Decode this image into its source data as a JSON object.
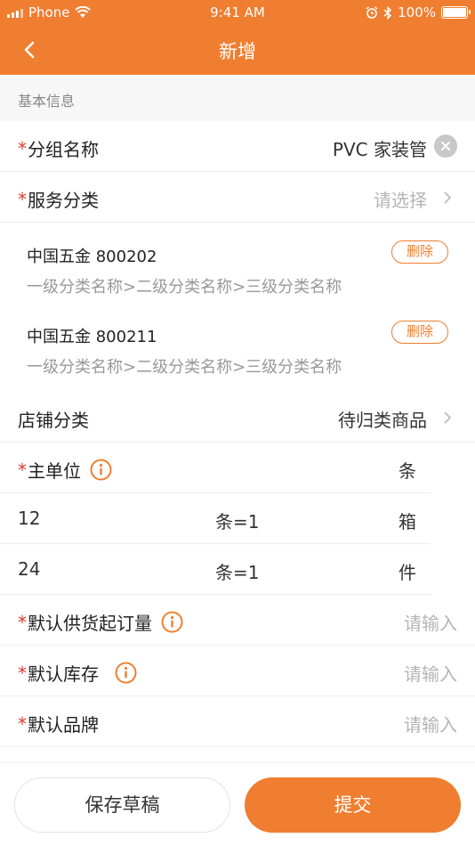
{
  "status_bar": {
    "carrier": "Phone",
    "time": "9:41 AM",
    "battery": "100%",
    "battery_level": 1.0,
    "icons": [
      "signal-icon",
      "wifi-icon",
      "alarm-icon",
      "bluetooth-icon",
      "battery-icon"
    ]
  },
  "nav": {
    "title": "新增",
    "back_icon": "chevron-left-icon"
  },
  "section_title": "基本信息",
  "form": {
    "group_name": {
      "required_mark": "*",
      "label": "分组名称",
      "value": "PVC 家装管"
    },
    "service_category": {
      "required_mark": "*",
      "label": "服务分类",
      "placeholder": "请选择"
    },
    "categories": [
      {
        "code": "中国五金 800202",
        "path": "一级分类名称>二级分类名称>三级分类名称",
        "delete_label": "删除"
      },
      {
        "code": "中国五金 800211",
        "path": "一级分类名称>二级分类名称>三级分类名称",
        "delete_label": "删除"
      }
    ],
    "store_category": {
      "label": "店铺分类",
      "value": "待归类商品"
    },
    "main_unit": {
      "required_mark": "*",
      "label": "主单位",
      "value": "条"
    },
    "unit_conversions": [
      {
        "qty": "12",
        "equals": "条=1",
        "unit": "箱"
      },
      {
        "qty": "24",
        "equals": "条=1",
        "unit": "件"
      }
    ],
    "min_order_qty": {
      "required_mark": "*",
      "label": "默认供货起订量",
      "placeholder": "请输入"
    },
    "stock": {
      "required_mark": "*",
      "label": "默认库存",
      "placeholder": "请输入"
    },
    "brand": {
      "required_mark": "*",
      "label": "默认品牌",
      "placeholder": "请输入"
    }
  },
  "actions": {
    "save_draft": "保存草稿",
    "submit": "提交"
  },
  "colors": {
    "accent": "#F07E30",
    "required": "#E03A2E",
    "muted_text": "#999999",
    "placeholder": "#B5B5B5",
    "section_bg": "#F7F7F7"
  }
}
